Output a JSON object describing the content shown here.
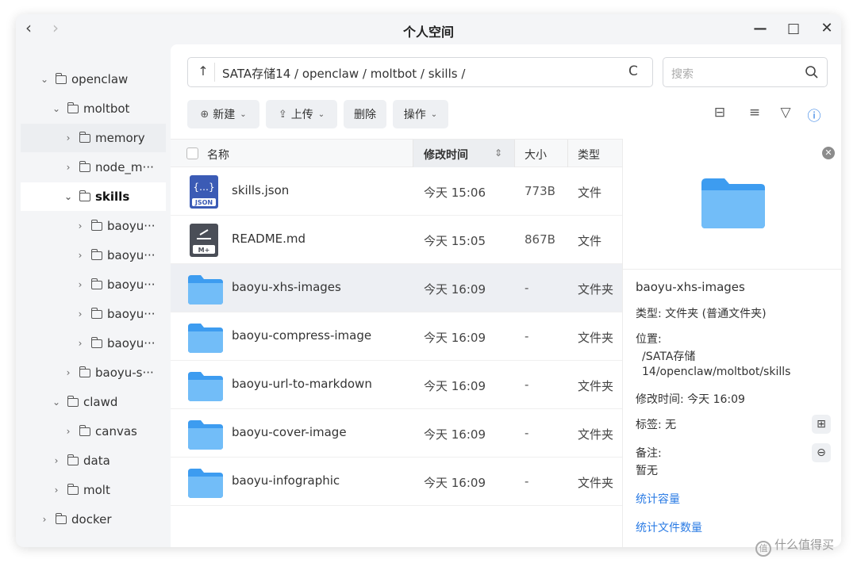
{
  "window": {
    "title": "个人空间",
    "back_glyph": "‹",
    "forward_glyph": "›",
    "minimize_glyph": "—",
    "maximize_glyph": "□",
    "close_glyph": "✕"
  },
  "sidebar": {
    "items": [
      {
        "label": "openclaw",
        "chev": "⌄"
      },
      {
        "label": "moltbot",
        "chev": "⌄"
      },
      {
        "label": "memory",
        "chev": "›"
      },
      {
        "label": "node_m···",
        "chev": "›"
      },
      {
        "label": "skills",
        "chev": "⌄"
      },
      {
        "label": "baoyu···",
        "chev": "›"
      },
      {
        "label": "baoyu···",
        "chev": "›"
      },
      {
        "label": "baoyu···",
        "chev": "›"
      },
      {
        "label": "baoyu···",
        "chev": "›"
      },
      {
        "label": "baoyu···",
        "chev": "›"
      },
      {
        "label": "baoyu-s···",
        "chev": "›"
      },
      {
        "label": "clawd",
        "chev": "⌄"
      },
      {
        "label": "canvas",
        "chev": "›"
      },
      {
        "label": "data",
        "chev": "›"
      },
      {
        "label": "molt",
        "chev": "›"
      },
      {
        "label": "docker",
        "chev": "›"
      }
    ]
  },
  "pathbar": {
    "up_glyph": "↑",
    "path": "SATA存储14 / openclaw / moltbot / skills /",
    "refresh_glyph": "C"
  },
  "search": {
    "placeholder": "搜索"
  },
  "toolbar": {
    "new": "新建",
    "upload": "上传",
    "delete": "删除",
    "actions": "操作",
    "dropdown_glyph": "⌄",
    "new_glyph": "⊕",
    "upload_glyph": "⇪"
  },
  "view_icons": {
    "grid": "⊟",
    "list": "≡",
    "filter": "▽",
    "info": "ⓘ"
  },
  "table": {
    "headers": {
      "name": "名称",
      "mtime": "修改时间",
      "size": "大小",
      "type": "类型",
      "sort_glyph": "⇕"
    },
    "rows": [
      {
        "name": "skills.json",
        "mtime": "今天 15:06",
        "size": "773B",
        "type": "文件",
        "icon": "json-file-icon",
        "badge": "JSON",
        "glyph": "{…}"
      },
      {
        "name": "README.md",
        "mtime": "今天 15:05",
        "size": "867B",
        "type": "文件",
        "icon": "markdown-file-icon",
        "badge": "M+",
        "glyph": ""
      },
      {
        "name": "baoyu-xhs-images",
        "mtime": "今天 16:09",
        "size": "-",
        "type": "文件夹",
        "icon": "folder-icon"
      },
      {
        "name": "baoyu-compress-image",
        "mtime": "今天 16:09",
        "size": "-",
        "type": "文件夹",
        "icon": "folder-icon"
      },
      {
        "name": "baoyu-url-to-markdown",
        "mtime": "今天 16:09",
        "size": "-",
        "type": "文件夹",
        "icon": "folder-icon"
      },
      {
        "name": "baoyu-cover-image",
        "mtime": "今天 16:09",
        "size": "-",
        "type": "文件夹",
        "icon": "folder-icon"
      },
      {
        "name": "baoyu-infographic",
        "mtime": "今天 16:09",
        "size": "-",
        "type": "文件夹",
        "icon": "folder-icon"
      }
    ]
  },
  "details": {
    "close_glyph": "✕",
    "name": "baoyu-xhs-images",
    "type_line": "类型: 文件夹 (普通文件夹)",
    "location_label": "位置:",
    "location_line1": "/SATA存储",
    "location_line2": "14/openclaw/moltbot/skills",
    "mtime_line": "修改时间: 今天 16:09",
    "tags_line": "标签: 无",
    "tags_add_glyph": "⊞",
    "note_label": "备注:",
    "note_value": "暂无",
    "note_edit_glyph": "⊖",
    "stat_size": "统计容量",
    "stat_count": "统计文件数量"
  },
  "watermark": {
    "text": "什么值得买",
    "glyph": "值"
  },
  "colors": {
    "accent": "#2a7be4",
    "folder_light": "#8fd0fb",
    "folder_dark": "#3d9cf0"
  }
}
